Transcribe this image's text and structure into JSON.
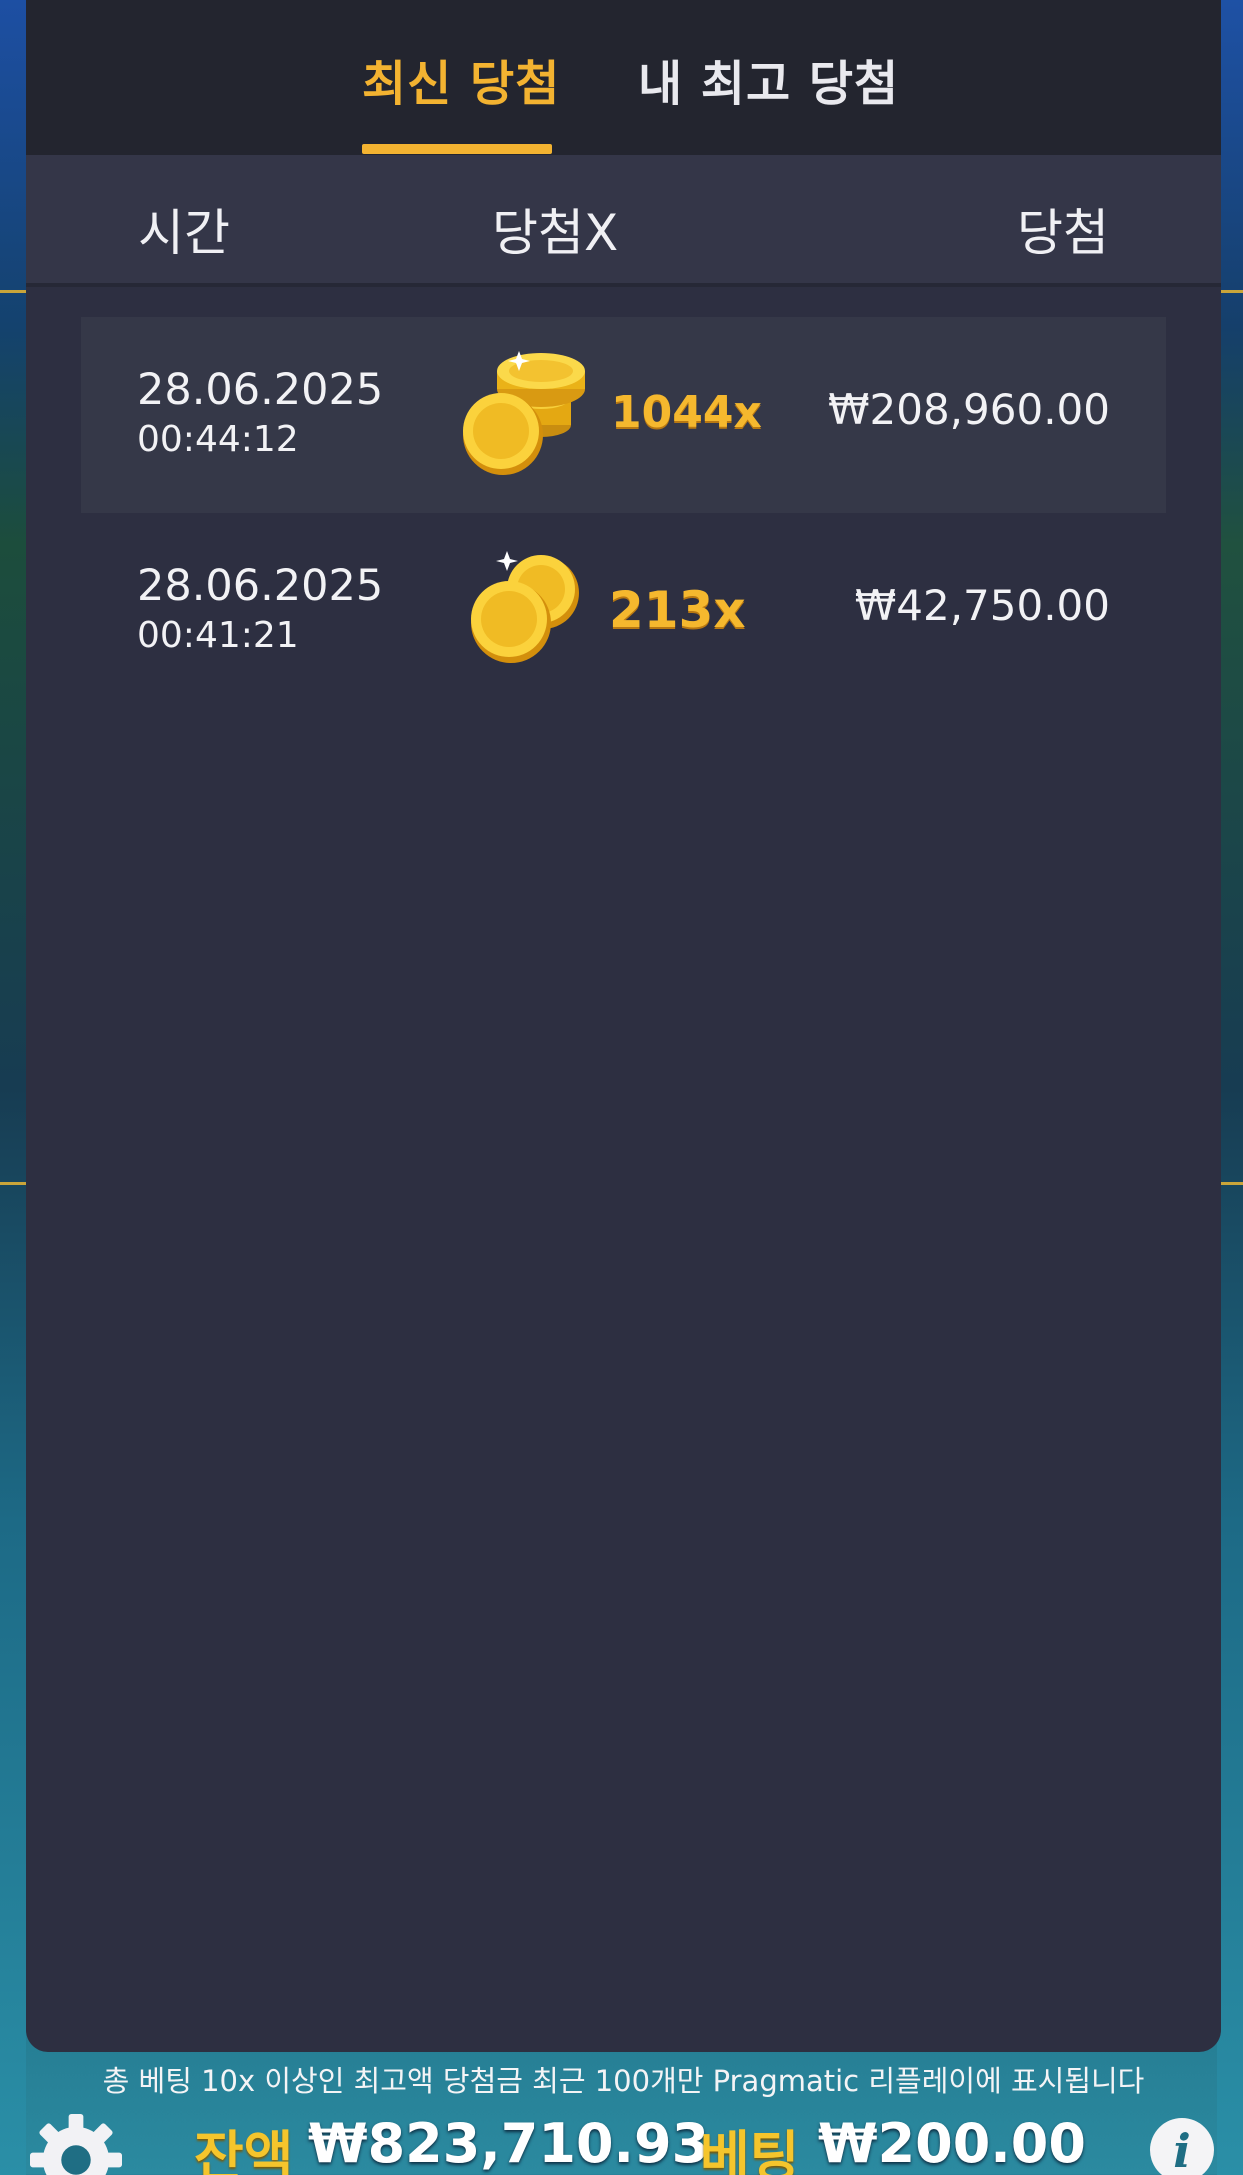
{
  "tabs": {
    "recent": "최신 당첨",
    "my_best": "내 최고 당첨"
  },
  "columns": {
    "time": "시간",
    "multiplier": "당첨X",
    "win": "당첨"
  },
  "rows": [
    {
      "date": "28.06.2025",
      "time": "00:44:12",
      "multiplier": "1044x",
      "amount": "₩208,960.00",
      "icon": "coin-stack-icon"
    },
    {
      "date": "28.06.2025",
      "time": "00:41:21",
      "multiplier": "213x",
      "amount": "₩42,750.00",
      "icon": "coin-pair-icon"
    }
  ],
  "footer_note": "총 베팅 10x 이상인 최고액 당첨금 최근 100개만 Pragmatic 리플레이에 표시됩니다",
  "bottom_bar": {
    "balance_label": "잔액",
    "balance_value": "₩823,710.93",
    "bet_label": "베팅",
    "bet_value": "₩200.00",
    "info_glyph": "i"
  },
  "colors": {
    "accent": "#f3b331",
    "panel": "#2d2f41",
    "tab_bar": "#23252f"
  }
}
